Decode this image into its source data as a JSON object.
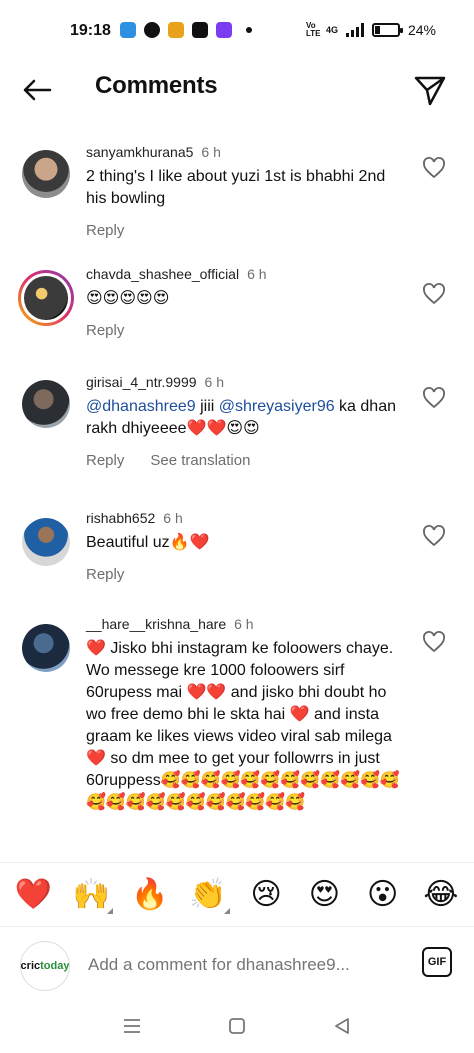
{
  "status_bar": {
    "time": "19:18",
    "network": "4G",
    "volte": "Vo LTE",
    "battery_percent_label": "24%",
    "battery_level": 0.24
  },
  "header": {
    "title": "Comments"
  },
  "comments": [
    {
      "username": "sanyamkhurana5",
      "time": "6 h",
      "text": "2 thing's I like about yuzi 1st is bhabhi 2nd his bowling",
      "reply": "Reply"
    },
    {
      "username": "chavda_shashee_official",
      "time": "6 h",
      "text": "😍😍😍😍😍",
      "reply": "Reply"
    },
    {
      "username": "girisai_4_ntr.9999",
      "time": "6 h",
      "mention1": "@dhanashree9",
      "text_mid": " jiii ",
      "mention2": "@shreyasiyer96",
      "text_end": " ka dhan rakh dhiyeeee❤️❤️😍😍",
      "reply": "Reply",
      "see_translation": "See translation"
    },
    {
      "username": "rishabh652",
      "time": "6 h",
      "text": "Beautiful uz🔥❤️",
      "reply": "Reply"
    },
    {
      "username": "__hare__krishna_hare",
      "time": "6 h",
      "text": "❤️ Jisko bhi instagram ke foloowers chaye. Wo messege kre  1000 foloowers sirf 60rupess mai ❤️❤️ and jisko bhi doubt ho wo free demo bhi le skta hai ❤️ and insta graam ke likes views video viral sab milega ❤️ so dm mee to get your followrrs in just 60ruppess🥰🥰🥰🥰🥰🥰🥰🥰🥰🥰🥰🥰🥰🥰🥰🥰🥰🥰🥰🥰🥰🥰🥰"
    }
  ],
  "emoji_bar": [
    "❤️",
    "🙌",
    "🔥",
    "👏",
    "😢",
    "😍",
    "😮",
    "😂"
  ],
  "input": {
    "avatar_text_a": "cric",
    "avatar_text_b": "today",
    "placeholder": "Add a comment for dhanashree9...",
    "gif_label": "GIF"
  }
}
